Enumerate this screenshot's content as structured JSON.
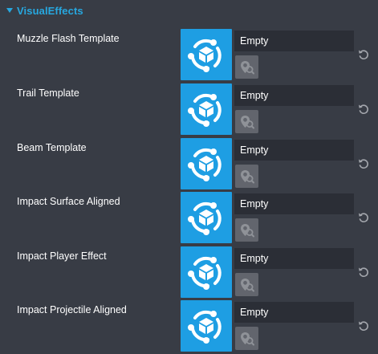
{
  "section": {
    "title": "VisualEffects",
    "accent_color": "#27a8e0"
  },
  "rows": [
    {
      "label": "Muzzle Flash Template",
      "value": "Empty"
    },
    {
      "label": "Trail Template",
      "value": "Empty"
    },
    {
      "label": "Beam Template",
      "value": "Empty"
    },
    {
      "label": "Impact Surface Aligned",
      "value": "Empty"
    },
    {
      "label": "Impact Player Effect",
      "value": "Empty"
    },
    {
      "label": "Impact Projectile Aligned",
      "value": "Empty"
    }
  ],
  "icons": {
    "thumbnail": "template-asset-icon",
    "pick": "asset-picker-icon",
    "reset": "reset-icon"
  },
  "colors": {
    "background": "#383c45",
    "thumbnail": "#1e9ee3",
    "field": "#2b2e36",
    "button": "#62656d"
  }
}
